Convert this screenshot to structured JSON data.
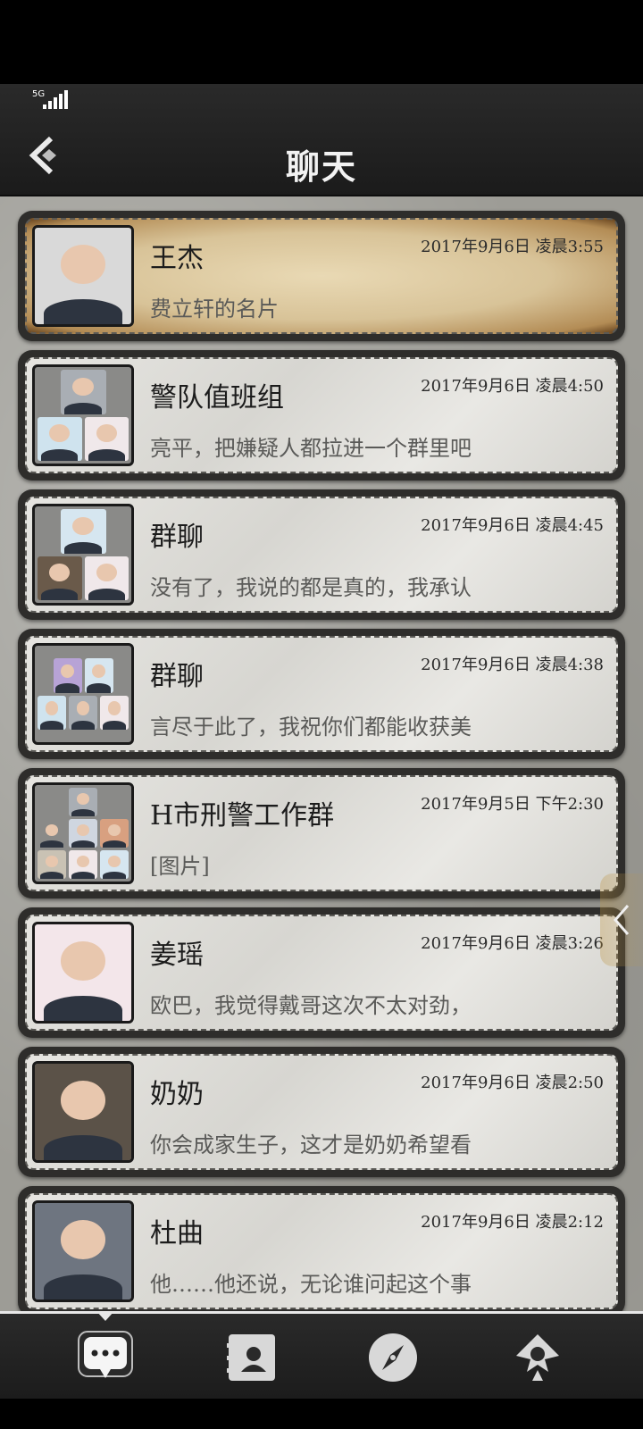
{
  "status_bar": {
    "network": "5G"
  },
  "header": {
    "title": "聊天"
  },
  "chats": [
    {
      "name": "王杰",
      "time": "2017年9月6日 凌晨3:55",
      "preview": "费立轩的名片",
      "highlight": true,
      "avatar_grid": "1"
    },
    {
      "name": "警队值班组",
      "time": "2017年9月6日 凌晨4:50",
      "preview": "亮平，把嫌疑人都拉进一个群里吧",
      "highlight": false,
      "avatar_grid": "3"
    },
    {
      "name": "群聊",
      "time": "2017年9月6日 凌晨4:45",
      "preview": "没有了，我说的都是真的，我承认",
      "highlight": false,
      "avatar_grid": "3"
    },
    {
      "name": "群聊",
      "time": "2017年9月6日 凌晨4:38",
      "preview": "言尽于此了，我祝你们都能收获美",
      "highlight": false,
      "avatar_grid": "5"
    },
    {
      "name": "H市刑警工作群",
      "time": "2017年9月5日 下午2:30",
      "preview": "[图片]",
      "highlight": false,
      "avatar_grid": "7"
    },
    {
      "name": "姜瑶",
      "time": "2017年9月6日 凌晨3:26",
      "preview": "欧巴，我觉得戴哥这次不太对劲，",
      "highlight": false,
      "avatar_grid": "1"
    },
    {
      "name": "奶奶",
      "time": "2017年9月6日 凌晨2:50",
      "preview": "你会成家生子，这才是奶奶希望看",
      "highlight": false,
      "avatar_grid": "1"
    },
    {
      "name": "杜曲",
      "time": "2017年9月6日 凌晨2:12",
      "preview": "他……他还说，无论谁问起这个事",
      "highlight": false,
      "avatar_grid": "1"
    }
  ],
  "tabbar": {
    "tabs": [
      {
        "icon": "chat-bubble-icon",
        "active": true
      },
      {
        "icon": "contacts-card-icon",
        "active": false
      },
      {
        "icon": "compass-icon",
        "active": false
      },
      {
        "icon": "spade-icon",
        "active": false
      }
    ]
  },
  "colors": {
    "accent_gold": "#c9a45c",
    "card_border": "#2e2d2b",
    "header_bg": "#222222"
  }
}
